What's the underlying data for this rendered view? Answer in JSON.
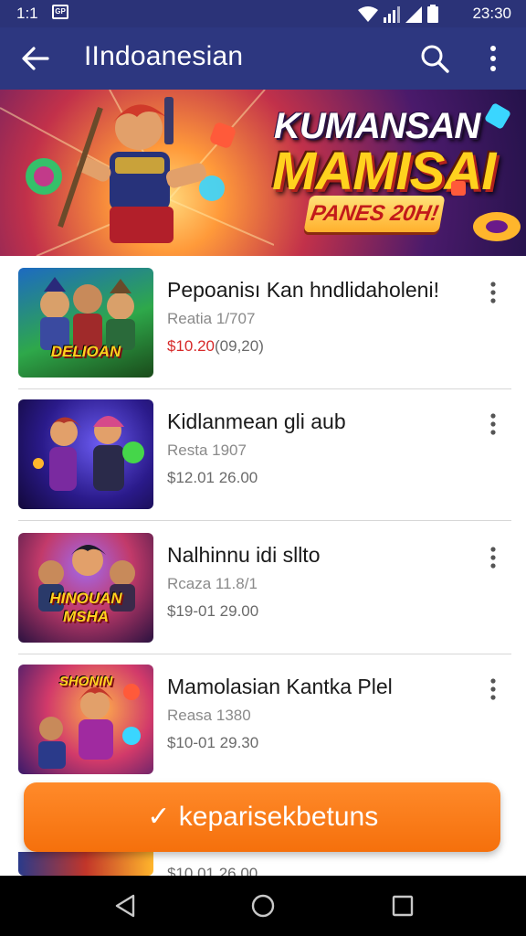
{
  "status_bar": {
    "time": "1:1",
    "notification_badge": "GP",
    "clock": "23:30"
  },
  "app_bar": {
    "title": "IIndoanesian"
  },
  "banner": {
    "headline_line1": "KUMANSAN",
    "headline_line2": "MAMISAI",
    "tag": "PANES 20H!"
  },
  "items": [
    {
      "name": "Pepoanisı Kan hndlidaholeni!",
      "meta": "Reatia 1/707",
      "price": "$10.20",
      "price_old": "(09,20)",
      "thumb_caption": "DELIOAN"
    },
    {
      "name": "Kidlanmean gli aub",
      "meta": "Resta 1907",
      "price": "$12.01 26.00",
      "price_old": "",
      "thumb_caption": ""
    },
    {
      "name": "Nalhinnu idi sllto",
      "meta": "Rcaza 11.8/1",
      "price": "$19-01 29.00",
      "price_old": "",
      "thumb_caption": "HINOUAN MSHA"
    },
    {
      "name": "Mamolasian Kantka Plel",
      "meta": "Reasa 1380",
      "price": "$10-01 29.30",
      "price_old": "",
      "thumb_caption": "SHONIN"
    }
  ],
  "partial_item": {
    "price": "$10.01 26.00"
  },
  "cta": {
    "label": "keparisekbetuns"
  },
  "icons": {
    "back": "arrow-left-icon",
    "search": "search-icon",
    "more": "more-vert-icon",
    "cta": "check-icon"
  },
  "colors": {
    "app_bar": "#2d3780",
    "status_bar": "#2b3378",
    "cta": "#f5700c",
    "price_hot": "#d72a2a"
  }
}
